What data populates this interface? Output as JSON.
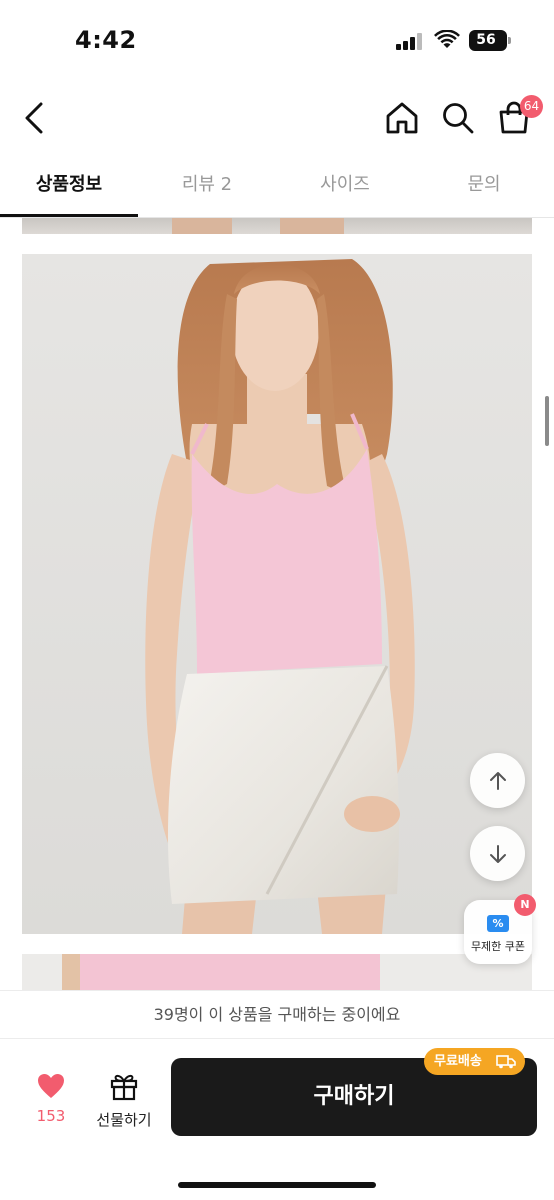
{
  "status_bar": {
    "time": "4:42",
    "battery": "56"
  },
  "top_nav": {
    "cart_count": "64"
  },
  "tabs": [
    {
      "label": "상품정보",
      "active": true
    },
    {
      "label": "리뷰 2",
      "active": false
    },
    {
      "label": "사이즈",
      "active": false
    },
    {
      "label": "문의",
      "active": false
    }
  ],
  "product_image": {
    "alt_icon": "product-photo-model-pink-camisole-white-skirt"
  },
  "floating": {
    "scroll_up_icon": "arrow-up-icon",
    "scroll_down_icon": "arrow-down-icon",
    "coupon_icon_glyph": "%",
    "coupon_label": "무제한 쿠폰",
    "coupon_badge": "N"
  },
  "bottom_bar": {
    "viewers_text": "39명이 이 상품을 구매하는 중이에요",
    "like_count": "153",
    "gift_label": "선물하기",
    "buy_label": "구매하기",
    "shipping_badge": "무료배송"
  },
  "colors": {
    "accent_pink": "#f25c6e",
    "shipping_orange": "#f5a623",
    "buy_button": "#1a1a1a"
  }
}
